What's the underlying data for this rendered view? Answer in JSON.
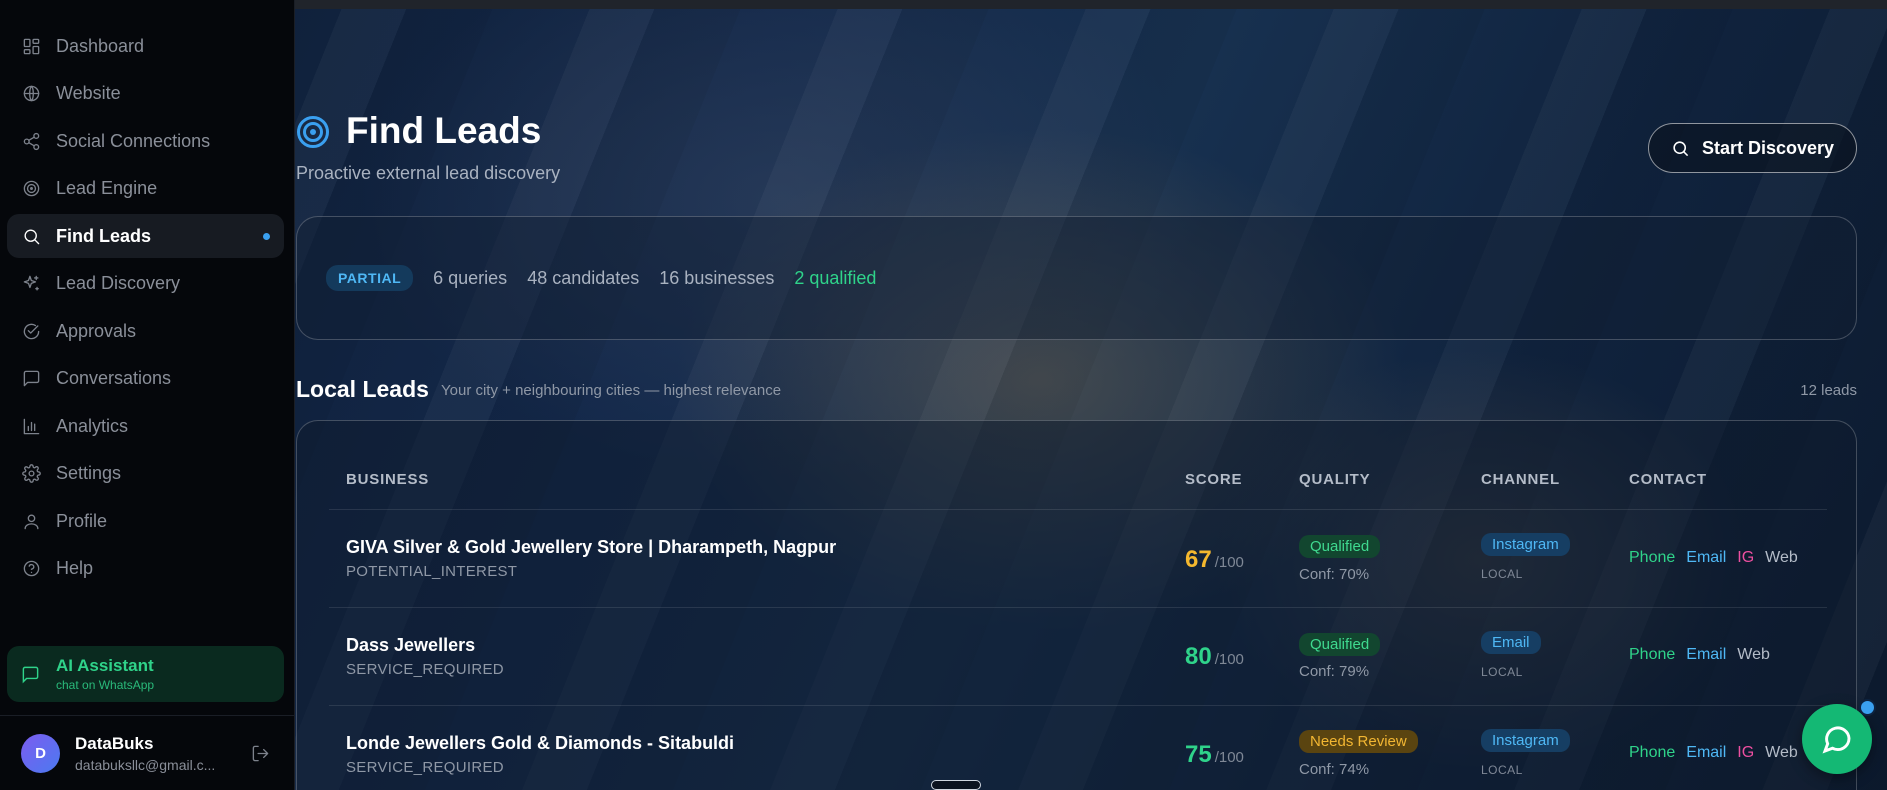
{
  "sidebar": {
    "items": [
      {
        "label": "Dashboard",
        "icon": "dashboard-icon"
      },
      {
        "label": "Website",
        "icon": "globe-icon"
      },
      {
        "label": "Social Connections",
        "icon": "share-icon"
      },
      {
        "label": "Lead Engine",
        "icon": "target-icon"
      },
      {
        "label": "Find Leads",
        "icon": "search-icon",
        "active": true
      },
      {
        "label": "Lead Discovery",
        "icon": "sparkle-icon"
      },
      {
        "label": "Approvals",
        "icon": "check-circle-icon"
      },
      {
        "label": "Conversations",
        "icon": "message-icon"
      },
      {
        "label": "Analytics",
        "icon": "bar-chart-icon"
      },
      {
        "label": "Settings",
        "icon": "gear-icon"
      },
      {
        "label": "Profile",
        "icon": "user-icon"
      },
      {
        "label": "Help",
        "icon": "help-icon"
      }
    ],
    "ai_assistant": {
      "title": "AI Assistant",
      "subtitle": "chat on WhatsApp"
    },
    "user": {
      "initial": "D",
      "name": "DataBuks",
      "email": "databuksllc@gmail.c..."
    }
  },
  "header": {
    "title": "Find Leads",
    "subtitle": "Proactive external lead discovery",
    "start_button": "Start Discovery"
  },
  "status": {
    "badge": "PARTIAL",
    "queries": "6 queries",
    "candidates": "48 candidates",
    "businesses": "16 businesses",
    "qualified": "2 qualified"
  },
  "local_leads": {
    "title": "Local Leads",
    "subtitle": "Your city + neighbouring cities — highest relevance",
    "count": "12 leads",
    "columns": {
      "business": "BUSINESS",
      "score": "SCORE",
      "quality": "QUALITY",
      "channel": "CHANNEL",
      "contact": "CONTACT"
    },
    "rows": [
      {
        "name": "GIVA Silver & Gold Jewellery Store | Dharampeth, Nagpur",
        "type": "POTENTIAL_INTEREST",
        "score": "67",
        "score_max": "/100",
        "score_color": "#f5b82e",
        "quality": "Qualified",
        "quality_kind": "qualified",
        "confidence": "Conf: 70%",
        "channel": "Instagram",
        "channel_scope": "LOCAL",
        "contacts": {
          "phone": "Phone",
          "email": "Email",
          "ig": "IG",
          "web": "Web"
        }
      },
      {
        "name": "Dass Jewellers",
        "type": "SERVICE_REQUIRED",
        "score": "80",
        "score_max": "/100",
        "score_color": "#2fd38a",
        "quality": "Qualified",
        "quality_kind": "qualified",
        "confidence": "Conf: 79%",
        "channel": "Email",
        "channel_scope": "LOCAL",
        "contacts": {
          "phone": "Phone",
          "email": "Email",
          "web": "Web"
        }
      },
      {
        "name": "Londe Jewellers Gold & Diamonds - Sitabuldi",
        "type": "SERVICE_REQUIRED",
        "score": "75",
        "score_max": "/100",
        "score_color": "#2fd38a",
        "quality": "Needs Review",
        "quality_kind": "review",
        "confidence": "Conf: 74%",
        "channel": "Instagram",
        "channel_scope": "LOCAL",
        "contacts": {
          "phone": "Phone",
          "email": "Email",
          "ig": "IG",
          "web": "Web"
        }
      }
    ]
  },
  "colors": {
    "accent": "#3aa0f0",
    "success": "#2fd38a",
    "warning": "#f5b82e",
    "whatsapp": "#14b874"
  }
}
